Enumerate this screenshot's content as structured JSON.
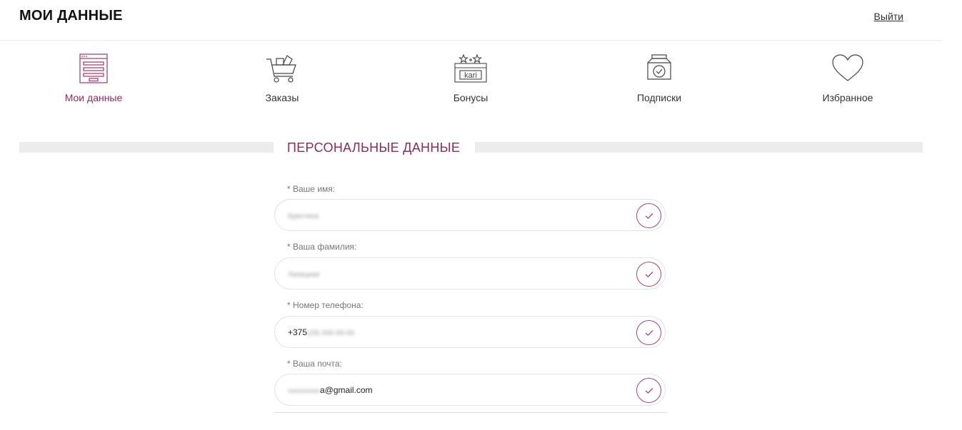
{
  "header": {
    "title": "МОИ ДАННЫЕ",
    "logout_label": "Выйти"
  },
  "nav": {
    "items": [
      {
        "label": "Мои данные",
        "icon": "profile-form-icon",
        "active": true
      },
      {
        "label": "Заказы",
        "icon": "cart-icon",
        "active": false
      },
      {
        "label": "Бонусы",
        "icon": "bonus-card-icon",
        "active": false
      },
      {
        "label": "Подписки",
        "icon": "subscription-icon",
        "active": false
      },
      {
        "label": "Избранное",
        "icon": "heart-icon",
        "active": false
      }
    ]
  },
  "section": {
    "title": "ПЕРСОНАЛЬНЫЕ ДАННЫЕ"
  },
  "form": {
    "fields": [
      {
        "label": "* Ваше имя:",
        "value_visible": "",
        "value_blurred": "Кристина"
      },
      {
        "label": "* Ваша фамилия:",
        "value_visible": "",
        "value_blurred": "Лапицкая"
      },
      {
        "label": "* Номер телефона:",
        "value_visible": "+375",
        "value_blurred": "(29) 000-00-00"
      },
      {
        "label": "* Ваша почта:",
        "value_visible": "a@gmail.com",
        "value_blurred": "xxxxxxxxx"
      }
    ]
  },
  "colors": {
    "accent": "#8a2b5e",
    "accent_light": "#a8427a",
    "divider": "#ececec"
  }
}
